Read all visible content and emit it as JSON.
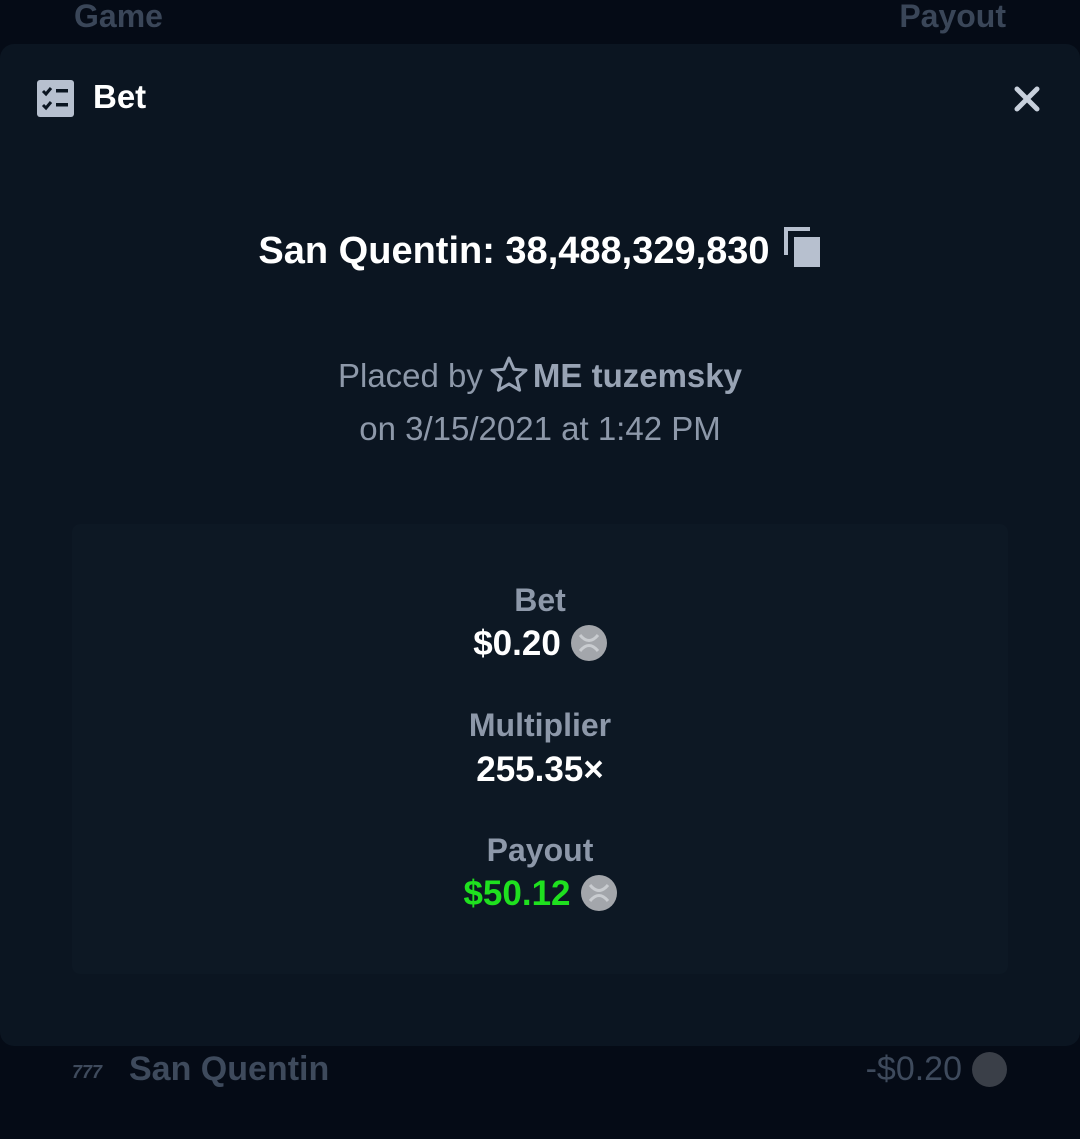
{
  "background": {
    "columns": {
      "game": "Game",
      "payout": "Payout"
    },
    "row": {
      "game": "San Quentin",
      "payout": "-$0.20"
    }
  },
  "modal": {
    "title": "Bet",
    "game_id_text": "San Quentin: 38,488,329,830",
    "placed_by_prefix": "Placed by",
    "username": "ME tuzemsky",
    "date_text": "on 3/15/2021 at 1:42 PM",
    "stats": {
      "bet_label": "Bet",
      "bet_value": "$0.20",
      "multiplier_label": "Multiplier",
      "multiplier_value": "255.35×",
      "payout_label": "Payout",
      "payout_value": "$50.12"
    },
    "colors": {
      "payout_green": "#1fe01f",
      "modal_bg": "#0b1521",
      "page_bg": "#050b16"
    },
    "icons": [
      "bet-slip-icon",
      "close-icon",
      "copy-icon",
      "star-icon",
      "xrp-coin-icon",
      "game-logo-icon"
    ]
  }
}
